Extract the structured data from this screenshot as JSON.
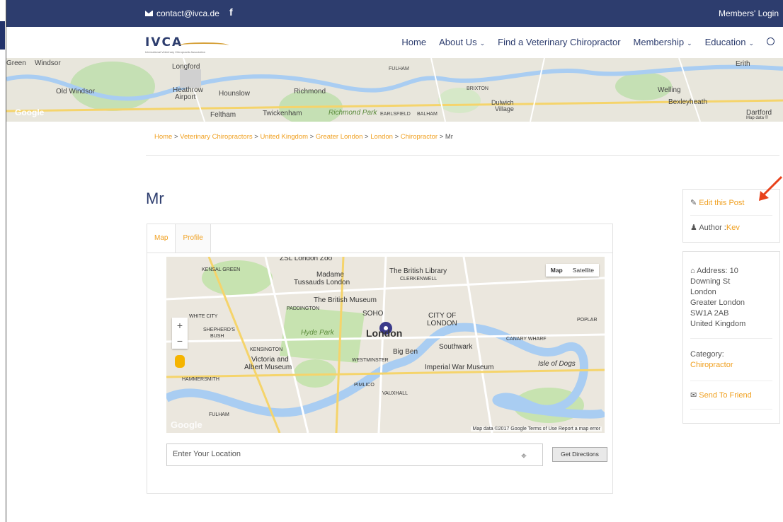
{
  "topbar": {
    "email": "contact@ivca.de",
    "social": "f",
    "login": "Members' Login"
  },
  "logo": {
    "text": "IVCA",
    "tagline": "International Veterinary Chiropractic Association"
  },
  "nav": {
    "items": [
      "Home",
      "About Us",
      "Find a Veterinary Chiropractor",
      "Membership",
      "Education"
    ]
  },
  "banner": {
    "labels": [
      "Green",
      "Windsor",
      "Old Windsor",
      "Longford",
      "Heathrow",
      "Airport",
      "Hounslow",
      "Richmond",
      "Feltham",
      "Twickenham",
      "Richmond Park",
      "FULHAM",
      "BRIXTON",
      "Dulwich",
      "Village",
      "EARLSFIELD",
      "BALHAM",
      "Erith",
      "Welling",
      "Bexleyheath",
      "Dartford",
      "Map data ©",
      "Google"
    ]
  },
  "breadcrumb": {
    "items": [
      "Home",
      "Veterinary Chiropractors",
      "United Kingdom",
      "Greater London",
      "London",
      "Chiropractor"
    ],
    "current": "Mr"
  },
  "page": {
    "title": "Mr"
  },
  "tabs": [
    "Map",
    "Profile"
  ],
  "map": {
    "type_buttons": [
      "Map",
      "Satellite"
    ],
    "labels": [
      "ZSL London Zoo",
      "KENSAL GREEN",
      "Madame",
      "Tussauds London",
      "The British Library",
      "CLERKENWELL",
      "The British Museum",
      "PADDINGTON",
      "SOHO",
      "CITY OF",
      "LONDON",
      "WHITE CITY",
      "Hyde Park",
      "London",
      "SHEPHERD'S",
      "BUSH",
      "KENSINGTON",
      "Big Ben",
      "Southwark",
      "Victoria and",
      "Albert Museum",
      "WESTMINSTER",
      "Imperial War Museum",
      "Isle of Dogs",
      "HAMMERSMITH",
      "PIMLICO",
      "VAUXHALL",
      "CANARY WHARF",
      "POPLAR",
      "FULHAM"
    ],
    "zoom_in": "+",
    "zoom_out": "−",
    "footer": "Map data ©2017 Google   Terms of Use   Report a map error",
    "watermark": "Google"
  },
  "directions": {
    "placeholder": "Enter Your Location",
    "button": "Get Directions"
  },
  "sidebar": {
    "edit": "Edit this Post",
    "author_label": "Author :",
    "author_name": "Kev",
    "address_label": "Address: 10",
    "address_lines": [
      "Downing St",
      "London",
      "Greater London",
      "SW1A 2AB",
      "United Kingdom"
    ],
    "category_label": "Category:",
    "category_value": "Chiropractor",
    "send": "Send To Friend"
  },
  "colors": {
    "navy": "#2d3d6e",
    "accent": "#f0a020",
    "arrow": "#e8421c"
  }
}
